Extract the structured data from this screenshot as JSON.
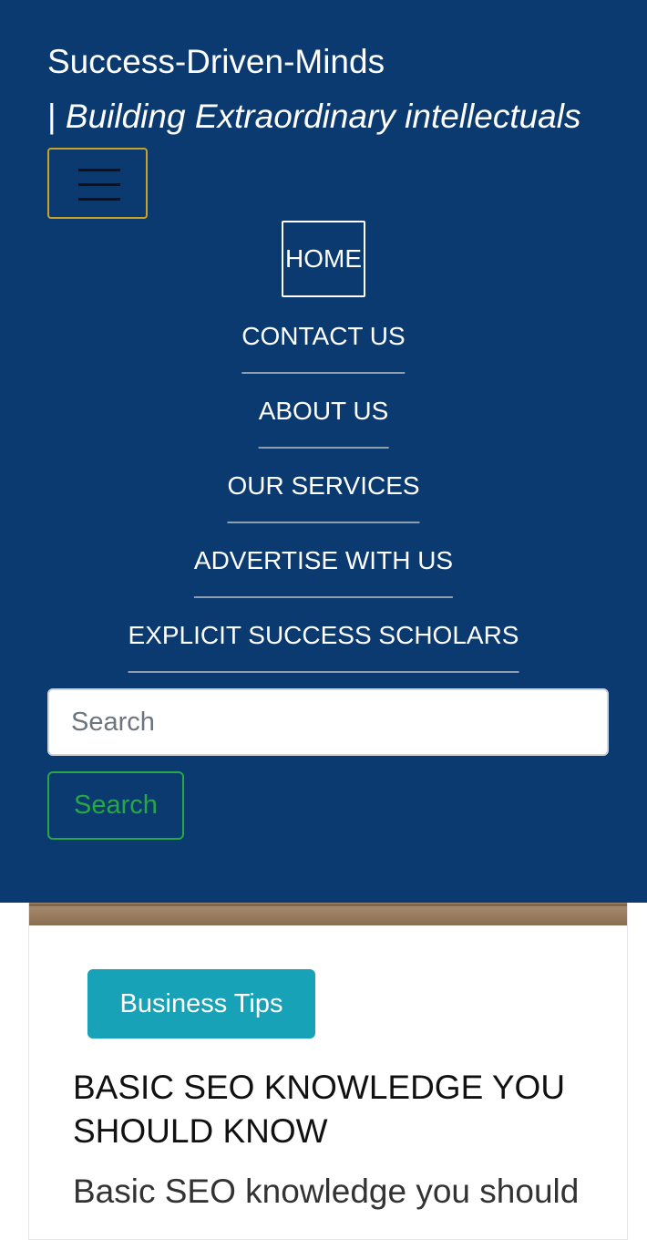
{
  "site": {
    "name": "Success-Driven-Minds",
    "tagline_sep": "| ",
    "tagline": "Building Extraordinary intellectuals"
  },
  "nav": {
    "items": [
      {
        "label": "HOME"
      },
      {
        "label": "CONTACT US"
      },
      {
        "label": "ABOUT US"
      },
      {
        "label": "OUR SERVICES"
      },
      {
        "label": "ADVERTISE WITH US"
      },
      {
        "label": "EXPLICIT SUCCESS SCHOLARS"
      }
    ]
  },
  "search": {
    "placeholder": "Search",
    "value": "",
    "button_label": "Search"
  },
  "post": {
    "category": "Business Tips",
    "title": "BASIC SEO KNOWLEDGE YOU SHOULD KNOW",
    "excerpt": "Basic SEO knowledge you should"
  },
  "colors": {
    "header_bg": "#0a3a70",
    "toggler_border": "#c9a227",
    "search_button": "#28a745",
    "badge": "#17a2b8"
  }
}
